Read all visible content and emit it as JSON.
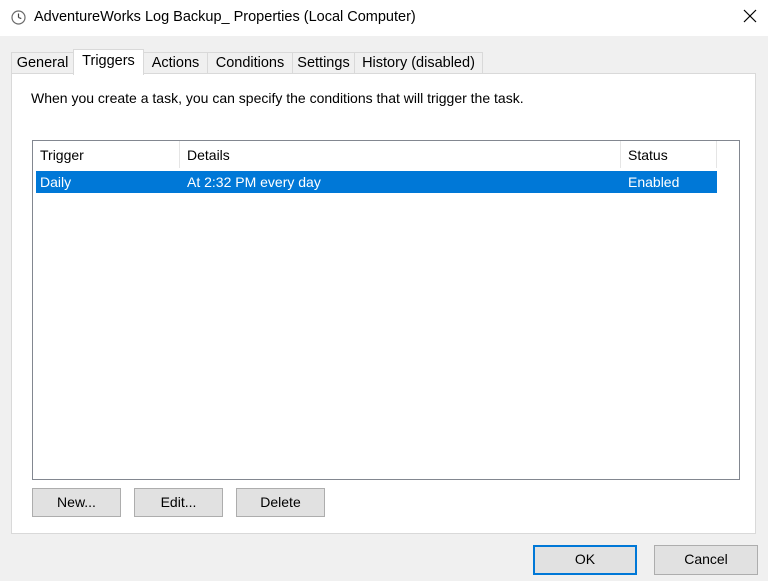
{
  "window": {
    "title": "AdventureWorks Log Backup_ Properties (Local Computer)",
    "icon": "clock-icon",
    "close_icon": "close-icon"
  },
  "tabs": [
    {
      "label": "General",
      "active": false
    },
    {
      "label": "Triggers",
      "active": true
    },
    {
      "label": "Actions",
      "active": false
    },
    {
      "label": "Conditions",
      "active": false
    },
    {
      "label": "Settings",
      "active": false
    },
    {
      "label": "History (disabled)",
      "active": false
    }
  ],
  "triggers": {
    "description": "When you create a task, you can specify the conditions that will trigger the task.",
    "columns": [
      "Trigger",
      "Details",
      "Status"
    ],
    "rows": [
      {
        "trigger": "Daily",
        "details": "At 2:32 PM every day",
        "status": "Enabled",
        "selected": true
      }
    ],
    "buttons": {
      "new": "New...",
      "edit": "Edit...",
      "delete": "Delete"
    }
  },
  "footer": {
    "ok": "OK",
    "cancel": "Cancel"
  },
  "colors": {
    "selection": "#0078d7",
    "default_button_border": "#0078d7"
  }
}
